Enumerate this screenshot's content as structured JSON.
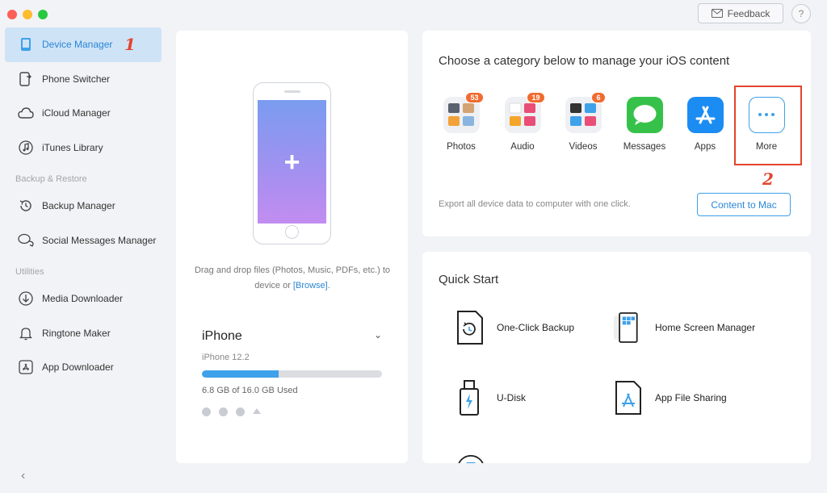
{
  "window": {
    "feedback_label": "Feedback",
    "help_label": "?"
  },
  "sidebar": {
    "items": [
      {
        "label": "Device Manager",
        "icon": "phone-icon"
      },
      {
        "label": "Phone Switcher",
        "icon": "phone-switch-icon"
      },
      {
        "label": "iCloud Manager",
        "icon": "cloud-icon"
      },
      {
        "label": "iTunes Library",
        "icon": "music-note-icon"
      }
    ],
    "section_backup": "Backup & Restore",
    "backup_items": [
      {
        "label": "Backup Manager",
        "icon": "history-icon"
      },
      {
        "label": "Social Messages Manager",
        "icon": "chat-bubbles-icon"
      }
    ],
    "section_utilities": "Utilities",
    "utility_items": [
      {
        "label": "Media Downloader",
        "icon": "download-icon"
      },
      {
        "label": "Ringtone Maker",
        "icon": "bell-icon"
      },
      {
        "label": "App Downloader",
        "icon": "app-store-icon"
      }
    ],
    "step_number": "1",
    "collapse_glyph": "‹"
  },
  "device": {
    "drop_text": "Drag and drop files (Photos, Music, PDFs, etc.) to device or",
    "browse_label": "[Browse]",
    "drop_end": ".",
    "name": "iPhone",
    "model": "iPhone 12.2",
    "storage_text": "6.8 GB of  16.0 GB Used",
    "storage_used_fraction": 0.425
  },
  "categories": {
    "title": "Choose a category below to manage your iOS content",
    "items": [
      {
        "label": "Photos",
        "badge": "53"
      },
      {
        "label": "Audio",
        "badge": "19"
      },
      {
        "label": "Videos",
        "badge": "6"
      },
      {
        "label": "Messages",
        "badge": ""
      },
      {
        "label": "Apps",
        "badge": ""
      },
      {
        "label": "More",
        "badge": ""
      }
    ],
    "step_number": "2",
    "export_text": "Export all device data to computer with one click.",
    "content_button": "Content to Mac"
  },
  "quick_start": {
    "title": "Quick Start",
    "items": [
      {
        "label": "One-Click Backup"
      },
      {
        "label": "Home Screen Manager"
      },
      {
        "label": "U-Disk"
      },
      {
        "label": "App File Sharing"
      }
    ]
  },
  "colors": {
    "accent": "#2a86d6",
    "highlight": "#e3442c",
    "badge": "#f06b2f"
  }
}
